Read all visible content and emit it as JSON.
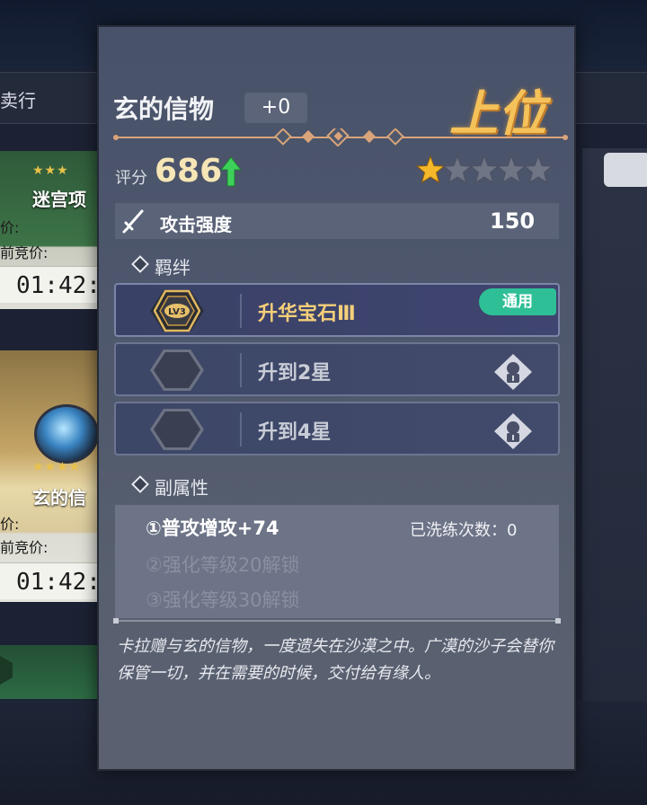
{
  "background": {
    "top_bar_label": "卖行",
    "cards": [
      {
        "title": "迷宫项",
        "line1": "价:",
        "line2": "前竞价:",
        "time": "01:42:"
      },
      {
        "title": "玄的信",
        "line1": "价:",
        "line2": "前竞价:",
        "time": "01:42:"
      }
    ]
  },
  "item": {
    "name": "玄的信物",
    "enhance_level": "+0",
    "rank": "上位",
    "score_label": "评分",
    "score": "686",
    "stars_filled": 1,
    "stars_total": 5,
    "main_stat": {
      "icon": "dagger-icon",
      "label": "攻击强度",
      "value": "150"
    },
    "bond_section_label": "羁绊",
    "bonds": [
      {
        "icon": "lv3-hex-badge-icon",
        "badge_text": "LV3",
        "label": "升华宝石Ⅲ",
        "tag": "通用",
        "active": true
      },
      {
        "icon": "empty-hex-icon",
        "label": "升到2星",
        "side_icon": "lock-sigil-icon",
        "active": false
      },
      {
        "icon": "empty-hex-icon",
        "label": "升到4星",
        "side_icon": "lock-sigil-icon",
        "active": false
      }
    ],
    "substat_section_label": "副属性",
    "substats": [
      {
        "text": "①普攻增攻+74",
        "unlocked": true
      },
      {
        "text": "②强化等级20解锁",
        "unlocked": false
      },
      {
        "text": "③强化等级30解锁",
        "unlocked": false
      }
    ],
    "refine_count_label": "已洗练次数：0",
    "description": "卡拉赠与玄的信物，一度遗失在沙漠之中。广漠的沙子会替你保管一切，并在需要的时候，交付给有缘人。"
  },
  "colors": {
    "rank_gold": "#f5c25a",
    "score_gold": "#f6e6b6",
    "tag_green": "#2fbf97",
    "arrow_green": "#3ed15a",
    "star_gold": "#f5b82a"
  }
}
